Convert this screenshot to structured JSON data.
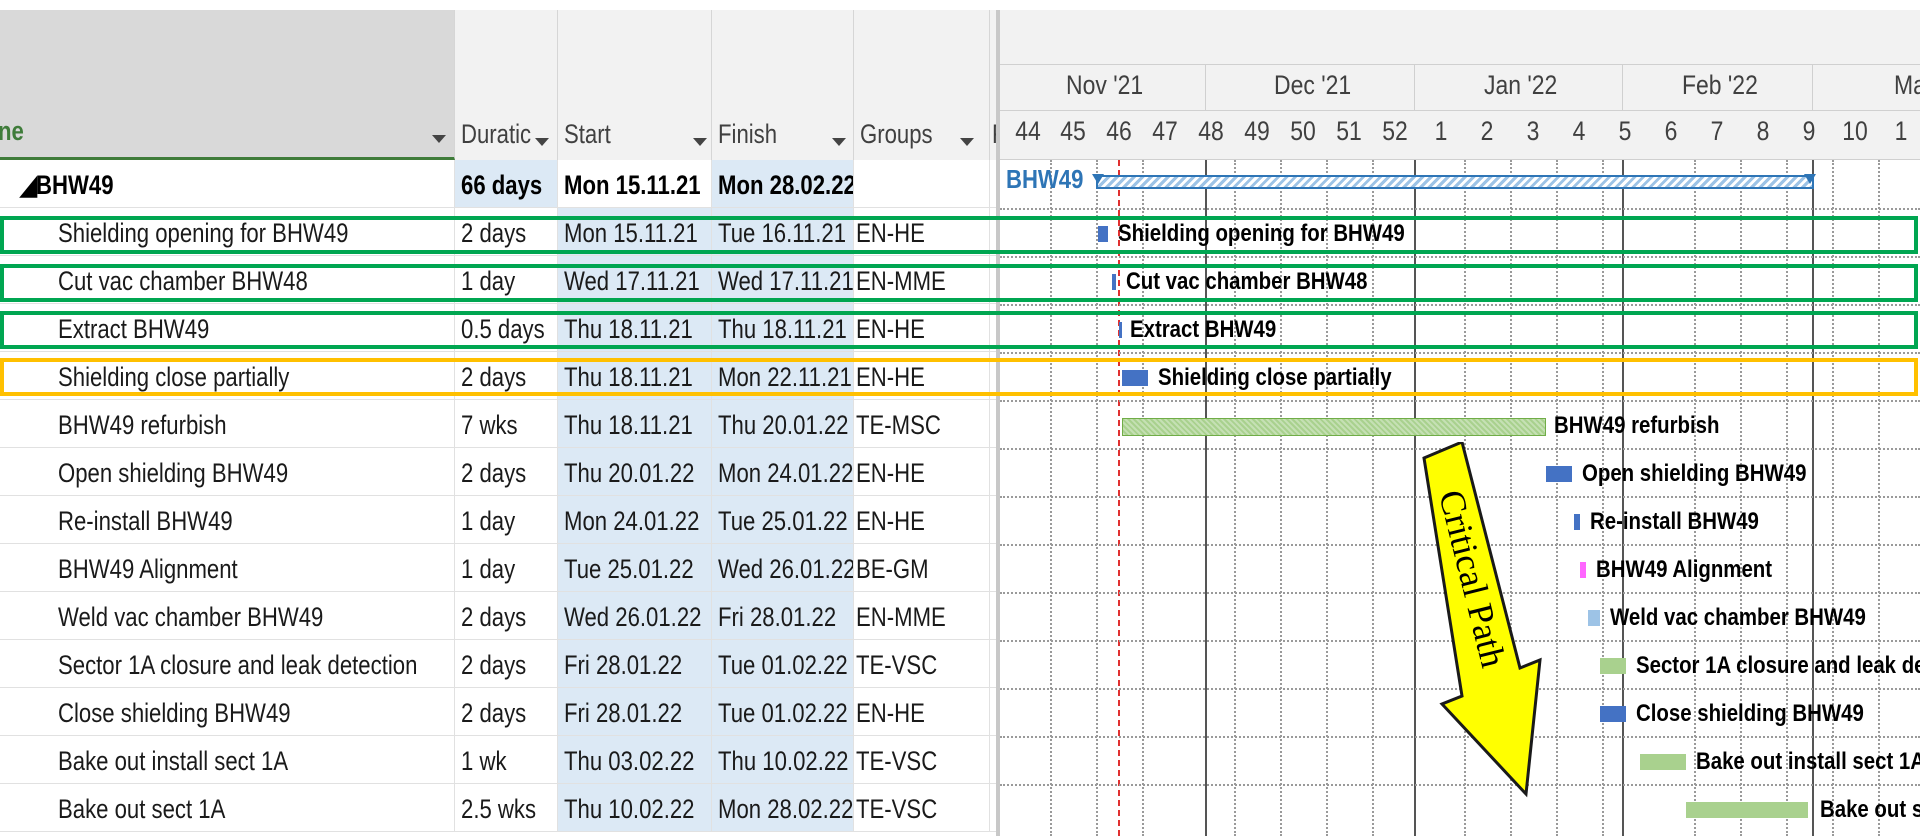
{
  "columns": {
    "name": "ne",
    "duration": "Duratic",
    "start": "Start",
    "finish": "Finish",
    "groups": "Groups",
    "extra": "F"
  },
  "summary": {
    "name": "BHW49",
    "duration": "66 days",
    "start": "Mon 15.11.21",
    "finish": "Mon 28.02.22"
  },
  "tasks": [
    {
      "name": "Shielding opening for BHW49",
      "duration": "2 days",
      "start": "Mon 15.11.21",
      "finish": "Tue 16.11.21",
      "group": "EN-HE"
    },
    {
      "name": "Cut vac chamber BHW48",
      "duration": "1 day",
      "start": "Wed 17.11.21",
      "finish": "Wed 17.11.21",
      "group": "EN-MME"
    },
    {
      "name": "Extract BHW49",
      "duration": "0.5 days",
      "start": "Thu 18.11.21",
      "finish": "Thu 18.11.21",
      "group": "EN-HE"
    },
    {
      "name": "Shielding close partially",
      "duration": "2 days",
      "start": "Thu 18.11.21",
      "finish": "Mon 22.11.21",
      "group": "EN-HE"
    },
    {
      "name": "BHW49 refurbish",
      "duration": "7 wks",
      "start": "Thu 18.11.21",
      "finish": "Thu 20.01.22",
      "group": "TE-MSC"
    },
    {
      "name": "Open shielding BHW49",
      "duration": "2 days",
      "start": "Thu 20.01.22",
      "finish": "Mon 24.01.22",
      "group": "EN-HE"
    },
    {
      "name": "Re-install BHW49",
      "duration": "1 day",
      "start": "Mon 24.01.22",
      "finish": "Tue 25.01.22",
      "group": "EN-HE"
    },
    {
      "name": "BHW49 Alignment",
      "duration": "1 day",
      "start": "Tue 25.01.22",
      "finish": "Wed 26.01.22",
      "group": "BE-GM"
    },
    {
      "name": "Weld vac chamber BHW49",
      "duration": "2 days",
      "start": "Wed 26.01.22",
      "finish": "Fri 28.01.22",
      "group": "EN-MME"
    },
    {
      "name": "Sector 1A closure and leak detection",
      "duration": "2 days",
      "start": "Fri 28.01.22",
      "finish": "Tue 01.02.22",
      "group": "TE-VSC"
    },
    {
      "name": "Close shielding BHW49",
      "duration": "2 days",
      "start": "Fri 28.01.22",
      "finish": "Tue 01.02.22",
      "group": "EN-HE"
    },
    {
      "name": "Bake out install sect 1A",
      "duration": "1 wk",
      "start": "Thu 03.02.22",
      "finish": "Thu 10.02.22",
      "group": "TE-VSC"
    },
    {
      "name": "Bake out sect 1A",
      "duration": "2.5 wks",
      "start": "Thu 10.02.22",
      "finish": "Mon 28.02.22",
      "group": "TE-VSC"
    }
  ],
  "timescale": {
    "months": [
      "Nov '21",
      "Dec '21",
      "Jan '22",
      "Feb '22",
      "Mar"
    ],
    "weeks": [
      "44",
      "45",
      "46",
      "47",
      "48",
      "49",
      "50",
      "51",
      "52",
      "1",
      "2",
      "3",
      "4",
      "5",
      "6",
      "7",
      "8",
      "9",
      "10",
      "1"
    ]
  },
  "gantt": {
    "summary_label": "BHW49",
    "bar_labels": [
      "Shielding opening for BHW49",
      "Cut vac chamber BHW48",
      "Extract BHW49",
      "Shielding close partially",
      "BHW49 refurbish",
      "Open shielding BHW49",
      "Re-install BHW49",
      "BHW49 Alignment",
      "Weld vac chamber BHW49",
      "Sector 1A closure and leak de",
      "Close shielding BHW49",
      "Bake out install sect 1A",
      "Bake out s"
    ],
    "annotation": "Critical Path"
  },
  "colors": {
    "green_highlight": "#00a651",
    "yellow_highlight": "#ffc000",
    "task_bar_blue": "#4472c4",
    "refurbish_bar": "#a9d18e",
    "summary_blue": "#2e75b6",
    "alignment_bar": "#ff66ff",
    "weld_bar": "#9dc3e6",
    "arrow_fill": "#ffff00"
  }
}
